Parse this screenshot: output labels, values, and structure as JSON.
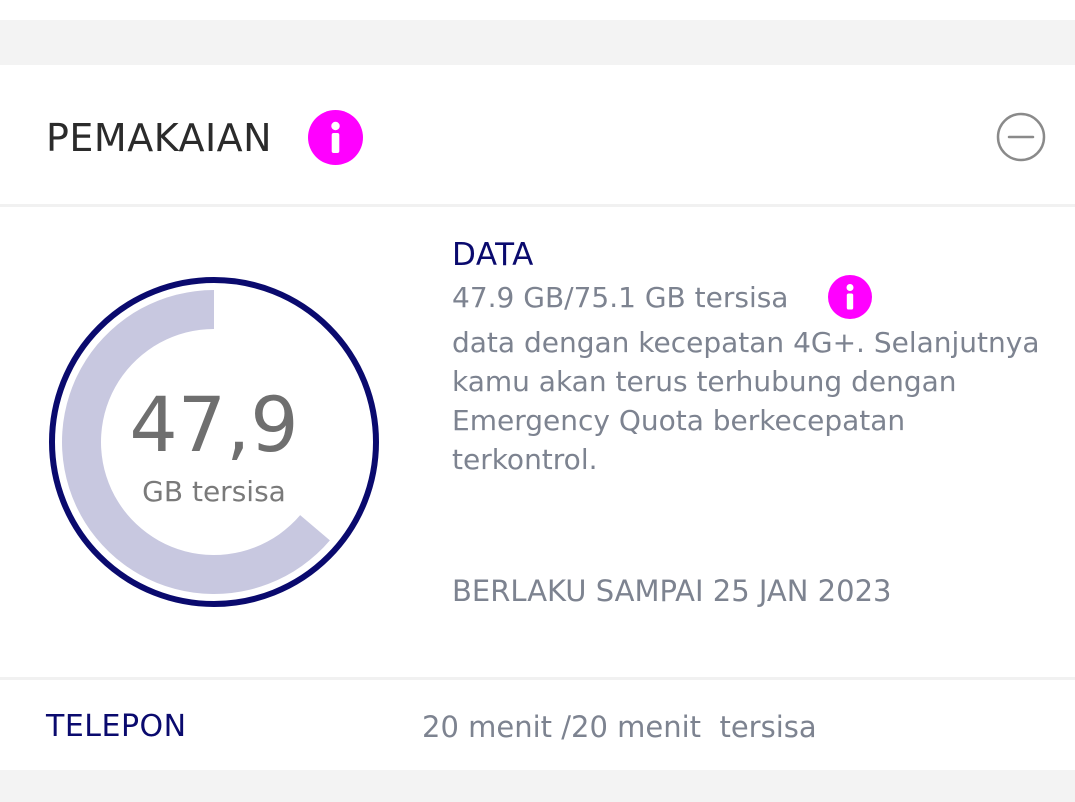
{
  "usage": {
    "title": "PEMAKAIAN",
    "info_icon": "info-icon",
    "collapse_icon": "minus-circle-icon",
    "colors": {
      "accent": "#ff00ff",
      "navy": "#0a0a6e",
      "gauge_track": "#c8c8e0"
    }
  },
  "data": {
    "gauge_value": "47,9",
    "gauge_unit": "GB tersisa",
    "remaining_fraction": 0.638,
    "title": "DATA",
    "amount": "47.9 GB/75.1 GB tersisa",
    "description": "data dengan kecepatan 4G+. Selanjutnya kamu akan terus terhubung dengan Emergency Quota berkecepatan terkontrol.",
    "valid_until": "BERLAKU SAMPAI 25 JAN 2023"
  },
  "phone": {
    "label": "TELEPON",
    "value": "20 menit /20 menit  tersisa"
  }
}
